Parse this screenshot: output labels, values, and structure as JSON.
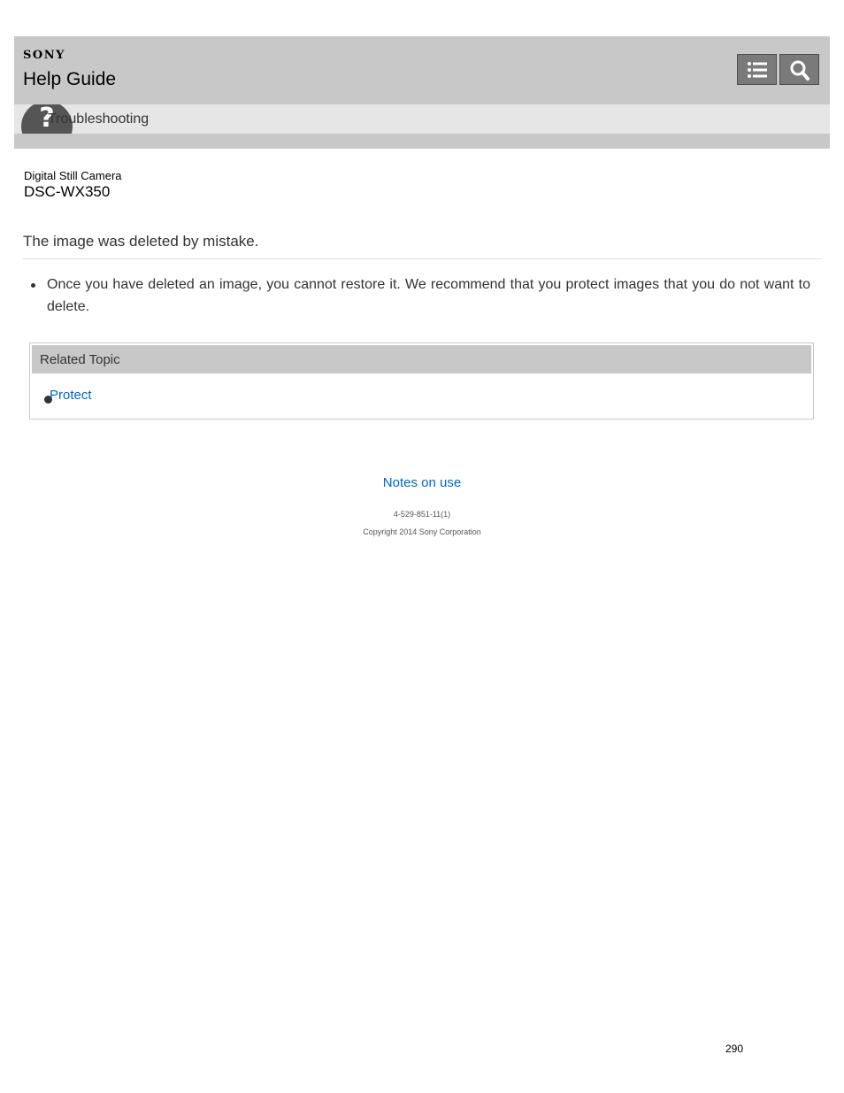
{
  "header": {
    "brand": "SONY",
    "title": "Help Guide",
    "category": "Troubleshooting",
    "category_icon": "question-mark-icon",
    "toc_icon": "list-icon",
    "search_icon": "search-icon"
  },
  "product": {
    "type": "Digital Still Camera",
    "model": "DSC-WX350"
  },
  "article": {
    "heading": "The image was deleted by mistake.",
    "bullets": [
      "Once you have deleted an image, you cannot restore it. We recommend that you protect images that you do not want to delete."
    ]
  },
  "related": {
    "heading": "Related Topic",
    "links": [
      "Protect"
    ]
  },
  "footer": {
    "notes_link": "Notes on use",
    "code": "4-529-851-11(1)",
    "copyright": "Copyright 2014 Sony Corporation"
  },
  "page_number": "290",
  "colors": {
    "header_bg": "#c8c8c8",
    "category_bg": "#e6e6e6",
    "link": "#0066cc",
    "button_bg": "#7a7a7a"
  }
}
